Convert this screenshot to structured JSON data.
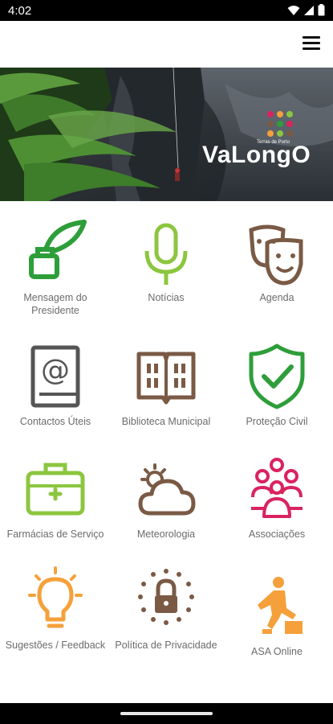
{
  "status_bar": {
    "time": "4:02"
  },
  "app_bar": {
    "menu_icon": "hamburger-menu-icon"
  },
  "hero": {
    "logo_text": "VaLongO",
    "logo_subtext": "Terras de Porto"
  },
  "tiles": [
    {
      "label": "Mensagem do Presidente",
      "icon": "quill-ink-icon",
      "color": "#2e9e3a"
    },
    {
      "label": "Notícias",
      "icon": "microphone-icon",
      "color": "#8cc63f"
    },
    {
      "label": "Agenda",
      "icon": "theater-masks-icon",
      "color": "#7a5a45"
    },
    {
      "label": "Contactos Úteis",
      "icon": "address-book-icon",
      "color": "#555555"
    },
    {
      "label": "Biblioteca Municipal",
      "icon": "open-book-icon",
      "color": "#7a5a45"
    },
    {
      "label": "Proteção Civil",
      "icon": "shield-check-icon",
      "color": "#2e9e3a"
    },
    {
      "label": "Farmácias de Serviço",
      "icon": "first-aid-kit-icon",
      "color": "#8cc63f"
    },
    {
      "label": "Meteorologia",
      "icon": "cloud-sun-icon",
      "color": "#7a5a45"
    },
    {
      "label": "Associações",
      "icon": "people-group-icon",
      "color": "#d9235f"
    },
    {
      "label": "Sugestões / Feedback",
      "icon": "lightbulb-icon",
      "color": "#f5a03a"
    },
    {
      "label": "Política de Privacidade",
      "icon": "padlock-stars-icon",
      "color": "#7a5a45"
    },
    {
      "label": "ASA Online",
      "icon": "person-step-icon",
      "color": "#f5a03a"
    }
  ]
}
